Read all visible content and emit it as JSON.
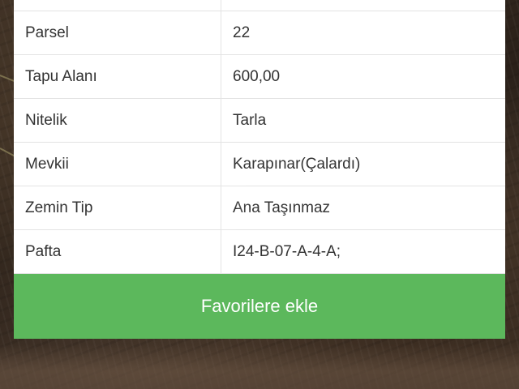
{
  "property_table": {
    "rows": [
      {
        "label": "",
        "value": ""
      },
      {
        "label": "Parsel",
        "value": "22"
      },
      {
        "label": "Tapu Alanı",
        "value": "600,00"
      },
      {
        "label": "Nitelik",
        "value": "Tarla"
      },
      {
        "label": "Mevkii",
        "value": "Karapınar(Çalardı)"
      },
      {
        "label": "Zemin Tip",
        "value": "Ana Taşınmaz"
      },
      {
        "label": "Pafta",
        "value": "I24-B-07-A-4-A;"
      }
    ]
  },
  "actions": {
    "favorite_label": "Favorilere ekle"
  },
  "colors": {
    "button_green": "#5cb85c",
    "card_bg": "#ffffff",
    "text": "#333333"
  }
}
